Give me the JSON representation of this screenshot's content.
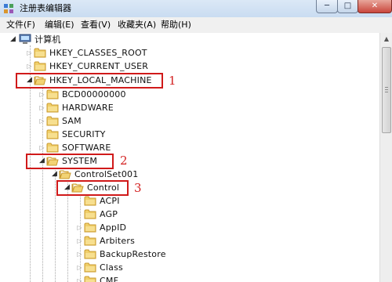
{
  "window": {
    "title": "注册表编辑器",
    "icon": "registry-editor-icon",
    "buttons": {
      "minimize": "─",
      "maximize": "□",
      "close": "✕"
    }
  },
  "menubar": {
    "items": [
      "文件(F)",
      "编辑(E)",
      "查看(V)",
      "收藏夹(A)",
      "帮助(H)"
    ]
  },
  "tree": {
    "root": "计算机",
    "nodes": [
      "HKEY_CLASSES_ROOT",
      "HKEY_CURRENT_USER",
      "HKEY_LOCAL_MACHINE",
      "BCD00000000",
      "HARDWARE",
      "SAM",
      "SECURITY",
      "SOFTWARE",
      "SYSTEM",
      "ControlSet001",
      "Control",
      "ACPI",
      "AGP",
      "AppID",
      "Arbiters",
      "BackupRestore",
      "Class",
      "CMF"
    ]
  },
  "annotations": [
    "1",
    "2",
    "3"
  ],
  "colors": {
    "highlight_box": "#d01a1a",
    "annotation_text": "#d32020",
    "folder": "#e8c25a"
  }
}
